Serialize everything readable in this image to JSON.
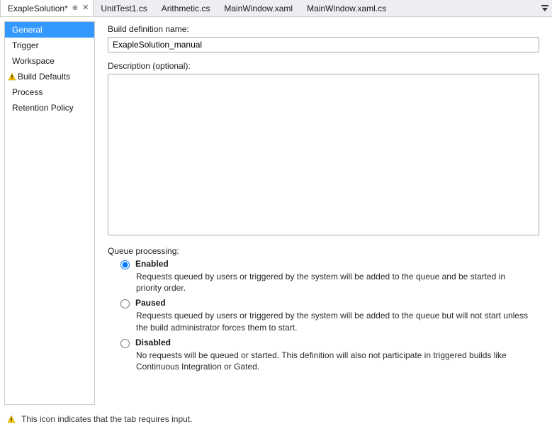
{
  "tabs": {
    "items": [
      {
        "label": "ExapleSolution*"
      },
      {
        "label": "UnitTest1.cs"
      },
      {
        "label": "Arithmetic.cs"
      },
      {
        "label": "MainWindow.xaml"
      },
      {
        "label": "MainWindow.xaml.cs"
      }
    ]
  },
  "sidebar": {
    "items": [
      {
        "label": "General"
      },
      {
        "label": "Trigger"
      },
      {
        "label": "Workspace"
      },
      {
        "label": "Build Defaults"
      },
      {
        "label": "Process"
      },
      {
        "label": "Retention Policy"
      }
    ]
  },
  "form": {
    "name_label": "Build definition name:",
    "name_value": "ExapleSolution_manual",
    "desc_label": "Description (optional):",
    "desc_value": "",
    "queue_label": "Queue processing:",
    "options": {
      "enabled": {
        "title": "Enabled",
        "desc": "Requests queued by users or triggered by the system will be added to the queue and be started in priority order."
      },
      "paused": {
        "title": "Paused",
        "desc": "Requests queued by users or triggered by the system will be added to the queue but will not start unless the build administrator forces them to start."
      },
      "disabled": {
        "title": "Disabled",
        "desc": "No requests will be queued or started. This definition will also not participate in triggered builds like Continuous Integration or Gated."
      }
    }
  },
  "footer": {
    "text": "This icon indicates that the tab requires input."
  }
}
